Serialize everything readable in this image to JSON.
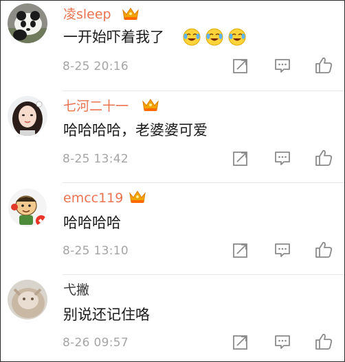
{
  "comments": [
    {
      "username": "凌sleep",
      "text": "一开始吓着我了",
      "emoji": [
        "laugh-cry-icon",
        "laugh-cry-icon",
        "laugh-cry-icon"
      ],
      "time": "8-25 20:16",
      "vip": true
    },
    {
      "username": "七河二十一",
      "text": "哈哈哈哈，老婆婆可爱",
      "emoji": [],
      "time": "8-25 13:42",
      "vip": true
    },
    {
      "username": "emcc119",
      "text": "哈哈哈哈",
      "emoji": [],
      "time": "8-25 13:10",
      "vip": true
    },
    {
      "username": "弋撇",
      "text": "别说还记住咯",
      "emoji": [],
      "time": "8-26 09:57",
      "vip": false
    }
  ],
  "actions": [
    "share-icon",
    "comment-icon",
    "like-icon"
  ],
  "colors": {
    "vip_name": "#eb7350",
    "name": "#333333",
    "text": "#1a1a1a",
    "time": "#a5a5a5",
    "icon": "#8a8a8a",
    "crown": "#f2a400"
  }
}
